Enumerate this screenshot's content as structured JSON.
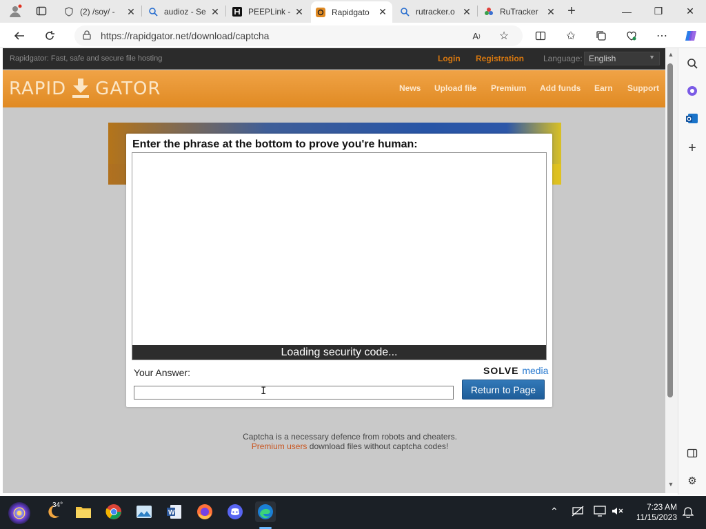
{
  "browser": {
    "tabs": [
      {
        "title": "(2) /soy/ -",
        "icon": "shield-icon"
      },
      {
        "title": "audioz - Se",
        "icon": "search-icon"
      },
      {
        "title": "PEEPLink -",
        "icon": "peeplink-icon"
      },
      {
        "title": "Rapidgato",
        "icon": "rapidgator-icon",
        "active": true
      },
      {
        "title": "rutracker.o",
        "icon": "search-icon"
      },
      {
        "title": "RuTracker",
        "icon": "rutracker-icon"
      }
    ],
    "url": "https://rapidgator.net/download/captcha"
  },
  "site": {
    "tagline": "Rapidgator: Fast, safe and secure file hosting",
    "login": "Login",
    "registration": "Registration",
    "language_label": "Language:",
    "language_value": "English",
    "logo_left": "RAPID",
    "logo_right": "GATOR",
    "nav": [
      "News",
      "Upload file",
      "Premium",
      "Add funds",
      "Earn",
      "Support"
    ]
  },
  "captcha": {
    "heading": "Enter the phrase at the bottom to prove you're human:",
    "loading": "Loading security code...",
    "answer_label": "Your Answer:",
    "answer_value": "",
    "provider_a": "SOLVE",
    "provider_b": "media",
    "return_button": "Return to Page"
  },
  "footer": {
    "line1": "Captcha is a necessary defence from robots and cheaters.",
    "premium_link": "Premium users",
    "line2_rest": " download files without captcha codes!"
  },
  "taskbar": {
    "weather_temp": "34°",
    "time": "7:23 AM",
    "date": "11/15/2023"
  },
  "colors": {
    "header_orange": "#e39127",
    "link_orange": "#d8780f",
    "button_blue": "#2a6eab",
    "page_bg": "#c9c9c9"
  }
}
